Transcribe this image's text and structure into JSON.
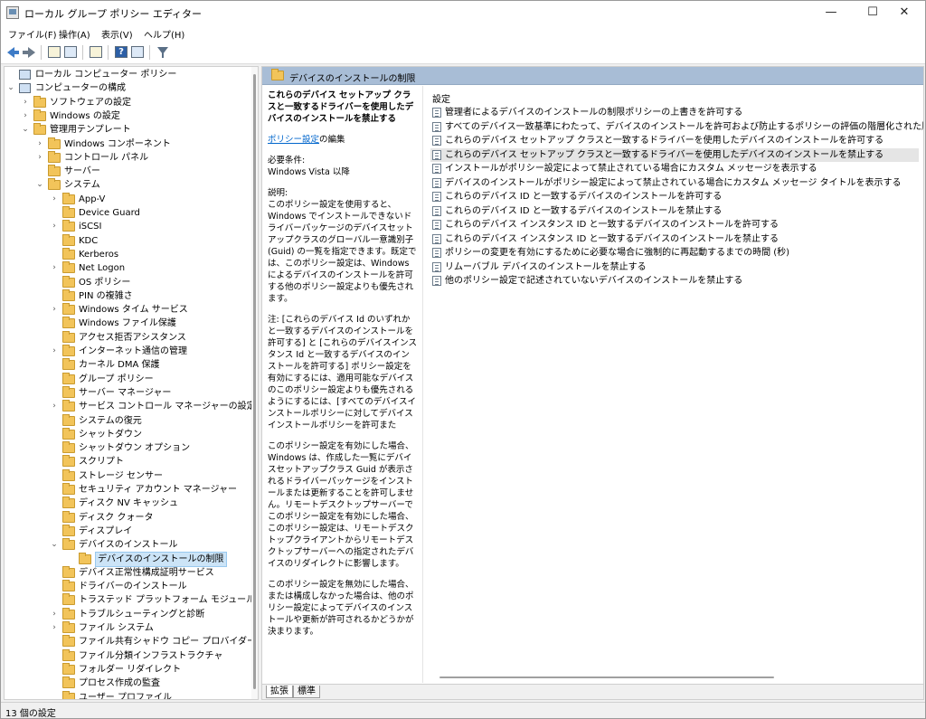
{
  "window": {
    "title": "ローカル グループ ポリシー エディター",
    "min": "—",
    "max": "☐",
    "close": "✕"
  },
  "menu": [
    "ファイル(F)",
    "操作(A)",
    "表示(V)",
    "ヘルプ(H)"
  ],
  "toolbar": {
    "help_glyph": "?"
  },
  "tree": [
    {
      "label": "ローカル コンピューター ポリシー",
      "level": 0,
      "tw": "",
      "icon": "pc"
    },
    {
      "label": "コンピューターの構成",
      "level": 0,
      "tw": "⌄",
      "icon": "pc"
    },
    {
      "label": "ソフトウェアの設定",
      "level": 1,
      "tw": "›",
      "icon": "folder"
    },
    {
      "label": "Windows の設定",
      "level": 1,
      "tw": "›",
      "icon": "folder"
    },
    {
      "label": "管理用テンプレート",
      "level": 1,
      "tw": "⌄",
      "icon": "folder"
    },
    {
      "label": "Windows コンポーネント",
      "level": 2,
      "tw": "›",
      "icon": "folder"
    },
    {
      "label": "コントロール パネル",
      "level": 2,
      "tw": "›",
      "icon": "folder"
    },
    {
      "label": "サーバー",
      "level": 2,
      "tw": "",
      "icon": "folder"
    },
    {
      "label": "システム",
      "level": 2,
      "tw": "⌄",
      "icon": "folder"
    },
    {
      "label": "App-V",
      "level": 3,
      "tw": "›",
      "icon": "folder"
    },
    {
      "label": "Device Guard",
      "level": 3,
      "tw": "",
      "icon": "folder"
    },
    {
      "label": "iSCSI",
      "level": 3,
      "tw": "›",
      "icon": "folder"
    },
    {
      "label": "KDC",
      "level": 3,
      "tw": "",
      "icon": "folder"
    },
    {
      "label": "Kerberos",
      "level": 3,
      "tw": "",
      "icon": "folder"
    },
    {
      "label": "Net Logon",
      "level": 3,
      "tw": "›",
      "icon": "folder"
    },
    {
      "label": "OS ポリシー",
      "level": 3,
      "tw": "",
      "icon": "folder"
    },
    {
      "label": "PIN の複雑さ",
      "level": 3,
      "tw": "",
      "icon": "folder"
    },
    {
      "label": "Windows タイム サービス",
      "level": 3,
      "tw": "›",
      "icon": "folder"
    },
    {
      "label": "Windows ファイル保護",
      "level": 3,
      "tw": "",
      "icon": "folder"
    },
    {
      "label": "アクセス拒否アシスタンス",
      "level": 3,
      "tw": "",
      "icon": "folder"
    },
    {
      "label": "インターネット通信の管理",
      "level": 3,
      "tw": "›",
      "icon": "folder"
    },
    {
      "label": "カーネル DMA 保護",
      "level": 3,
      "tw": "",
      "icon": "folder"
    },
    {
      "label": "グループ ポリシー",
      "level": 3,
      "tw": "",
      "icon": "folder"
    },
    {
      "label": "サーバー マネージャー",
      "level": 3,
      "tw": "",
      "icon": "folder"
    },
    {
      "label": "サービス コントロール マネージャーの設定",
      "level": 3,
      "tw": "›",
      "icon": "folder"
    },
    {
      "label": "システムの復元",
      "level": 3,
      "tw": "",
      "icon": "folder"
    },
    {
      "label": "シャットダウン",
      "level": 3,
      "tw": "",
      "icon": "folder"
    },
    {
      "label": "シャットダウン オプション",
      "level": 3,
      "tw": "",
      "icon": "folder"
    },
    {
      "label": "スクリプト",
      "level": 3,
      "tw": "",
      "icon": "folder"
    },
    {
      "label": "ストレージ センサー",
      "level": 3,
      "tw": "",
      "icon": "folder"
    },
    {
      "label": "セキュリティ アカウント マネージャー",
      "level": 3,
      "tw": "",
      "icon": "folder"
    },
    {
      "label": "ディスク NV キャッシュ",
      "level": 3,
      "tw": "",
      "icon": "folder"
    },
    {
      "label": "ディスク クォータ",
      "level": 3,
      "tw": "",
      "icon": "folder"
    },
    {
      "label": "ディスプレイ",
      "level": 3,
      "tw": "",
      "icon": "folder"
    },
    {
      "label": "デバイスのインストール",
      "level": 3,
      "tw": "⌄",
      "icon": "folder"
    },
    {
      "label": "デバイスのインストールの制限",
      "level": 4,
      "tw": "",
      "icon": "folder",
      "selected": true
    },
    {
      "label": "デバイス正常性構成証明サービス",
      "level": 3,
      "tw": "",
      "icon": "folder"
    },
    {
      "label": "ドライバーのインストール",
      "level": 3,
      "tw": "",
      "icon": "folder"
    },
    {
      "label": "トラステッド プラットフォーム モジュール サービス",
      "level": 3,
      "tw": "",
      "icon": "folder"
    },
    {
      "label": "トラブルシューティングと診断",
      "level": 3,
      "tw": "›",
      "icon": "folder"
    },
    {
      "label": "ファイル システム",
      "level": 3,
      "tw": "›",
      "icon": "folder"
    },
    {
      "label": "ファイル共有シャドウ コピー プロバイダー",
      "level": 3,
      "tw": "",
      "icon": "folder"
    },
    {
      "label": "ファイル分類インフラストラクチャ",
      "level": 3,
      "tw": "",
      "icon": "folder"
    },
    {
      "label": "フォルダー リダイレクト",
      "level": 3,
      "tw": "",
      "icon": "folder"
    },
    {
      "label": "プロセス作成の監査",
      "level": 3,
      "tw": "",
      "icon": "folder"
    },
    {
      "label": "ユーザー プロファイル",
      "level": 3,
      "tw": "",
      "icon": "folder"
    }
  ],
  "detail": {
    "header": "デバイスのインストールの制限",
    "policy_title": "これらのデバイス セットアップ クラスと一致するドライバーを使用したデバイスのインストールを禁止する",
    "edit_link": "ポリシー設定",
    "edit_suffix": "の編集",
    "requirements_label": "必要条件:",
    "requirements_value": "Windows Vista 以降",
    "description_label": "説明:",
    "paragraphs": [
      "このポリシー設定を使用すると、Windows でインストールできないドライバーパッケージのデバイスセットアップクラスのグローバル一意識別子 (Guid) の一覧を指定できます。既定では、このポリシー設定は、Windows によるデバイスのインストールを許可する他のポリシー設定よりも優先されます。",
      "注: [これらのデバイス Id のいずれかと一致するデバイスのインストールを許可する] と [これらのデバイスインスタンス Id と一致するデバイスのインストールを許可する] ポリシー設定を有効にするには、適用可能なデバイスのこのポリシー設定よりも優先されるようにするには、[すべてのデバイスインストールポリシーに対してデバイスインストールポリシーを許可また",
      "このポリシー設定を有効にした場合、Windows は、作成した一覧にデバイスセットアップクラス Guid が表示されるドライバーパッケージをインストールまたは更新することを許可しません。リモートデスクトップサーバーでこのポリシー設定を有効にした場合、このポリシー設定は、リモートデスクトップクライアントからリモートデスクトップサーバーへの指定されたデバイスのリダイレクトに影響します。",
      "このポリシー設定を無効にした場合、または構成しなかった場合は、他のポリシー設定によってデバイスのインストールや更新が許可されるかどうかが決まります。"
    ]
  },
  "settings": {
    "column_header": "設定",
    "items": [
      "管理者によるデバイスのインストールの制限ポリシーの上書きを許可する",
      "すべてのデバイス一致基準にわたって、デバイスのインストールを許可および防止するポリシーの評価の階層化された順序を適用します",
      "これらのデバイス セットアップ クラスと一致するドライバーを使用したデバイスのインストールを許可する",
      "これらのデバイス セットアップ クラスと一致するドライバーを使用したデバイスのインストールを禁止する",
      "インストールがポリシー設定によって禁止されている場合にカスタム メッセージを表示する",
      "デバイスのインストールがポリシー設定によって禁止されている場合にカスタム メッセージ タイトルを表示する",
      "これらのデバイス ID と一致するデバイスのインストールを許可する",
      "これらのデバイス ID と一致するデバイスのインストールを禁止する",
      "これらのデバイス インスタンス ID と一致するデバイスのインストールを許可する",
      "これらのデバイス インスタンス ID と一致するデバイスのインストールを禁止する",
      "ポリシーの変更を有効にするために必要な場合に強制的に再起動するまでの時間 (秒)",
      "リムーバブル デバイスのインストールを禁止する",
      "他のポリシー設定で記述されていないデバイスのインストールを禁止する"
    ],
    "selected_index": 3
  },
  "tabs": {
    "expanded": "拡張",
    "standard": "標準"
  },
  "status": "13 個の設定"
}
